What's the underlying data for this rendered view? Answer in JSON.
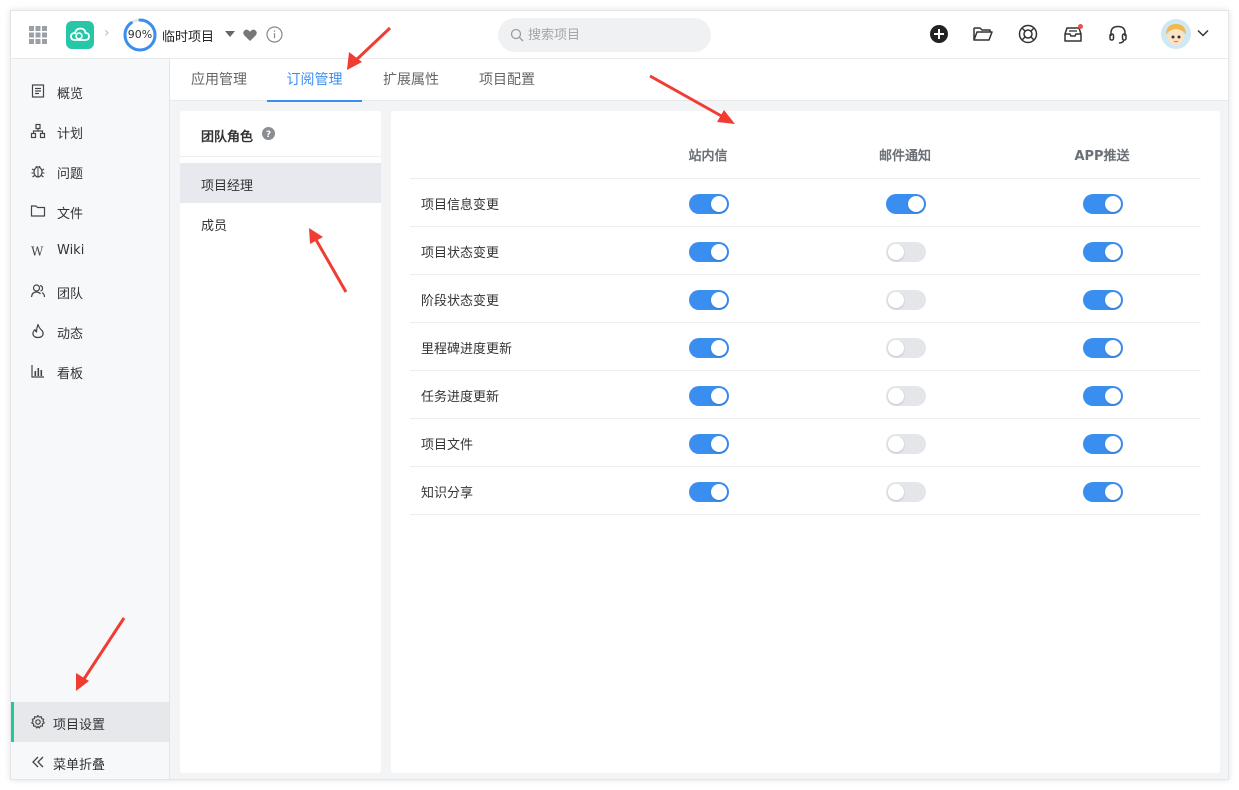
{
  "header": {
    "progress": "90%",
    "progress_value": 0.9,
    "project_name": "临时项目",
    "search_placeholder": "搜索项目",
    "icons": [
      "apps-grid-icon",
      "cloud-logo-icon",
      "heart-icon",
      "info-icon",
      "add-circle-icon",
      "folder-open-icon",
      "lifebuoy-icon",
      "inbox-icon",
      "headset-icon",
      "avatar"
    ],
    "inbox_badge": true
  },
  "sidebar": {
    "items": [
      {
        "label": "概览",
        "icon": "overview-icon"
      },
      {
        "label": "计划",
        "icon": "plan-icon"
      },
      {
        "label": "问题",
        "icon": "bug-icon"
      },
      {
        "label": "文件",
        "icon": "folder-icon"
      },
      {
        "label": "Wiki",
        "icon": "wiki-icon"
      },
      {
        "label": "团队",
        "icon": "team-icon"
      },
      {
        "label": "动态",
        "icon": "activity-icon"
      },
      {
        "label": "看板",
        "icon": "board-icon"
      }
    ],
    "settings_label": "项目设置",
    "collapse_label": "菜单折叠"
  },
  "tabs": [
    {
      "label": "应用管理",
      "active": false
    },
    {
      "label": "订阅管理",
      "active": true
    },
    {
      "label": "扩展属性",
      "active": false
    },
    {
      "label": "项目配置",
      "active": false
    }
  ],
  "roles": {
    "title": "团队角色",
    "items": [
      {
        "label": "项目经理",
        "active": true
      },
      {
        "label": "成员",
        "active": false
      }
    ]
  },
  "subscriptions": {
    "columns": [
      "站内信",
      "邮件通知",
      "APP推送"
    ],
    "rows": [
      {
        "label": "项目信息变更",
        "values": [
          true,
          true,
          true
        ]
      },
      {
        "label": "项目状态变更",
        "values": [
          true,
          false,
          true
        ]
      },
      {
        "label": "阶段状态变更",
        "values": [
          true,
          false,
          true
        ]
      },
      {
        "label": "里程碑进度更新",
        "values": [
          true,
          false,
          true
        ]
      },
      {
        "label": "任务进度更新",
        "values": [
          true,
          false,
          true
        ]
      },
      {
        "label": "项目文件",
        "values": [
          true,
          false,
          true
        ]
      },
      {
        "label": "知识分享",
        "values": [
          true,
          false,
          true
        ]
      }
    ]
  },
  "colors": {
    "accent": "#3a8ef0",
    "brand": "#26c6a6",
    "annotation": "#f03c32"
  }
}
